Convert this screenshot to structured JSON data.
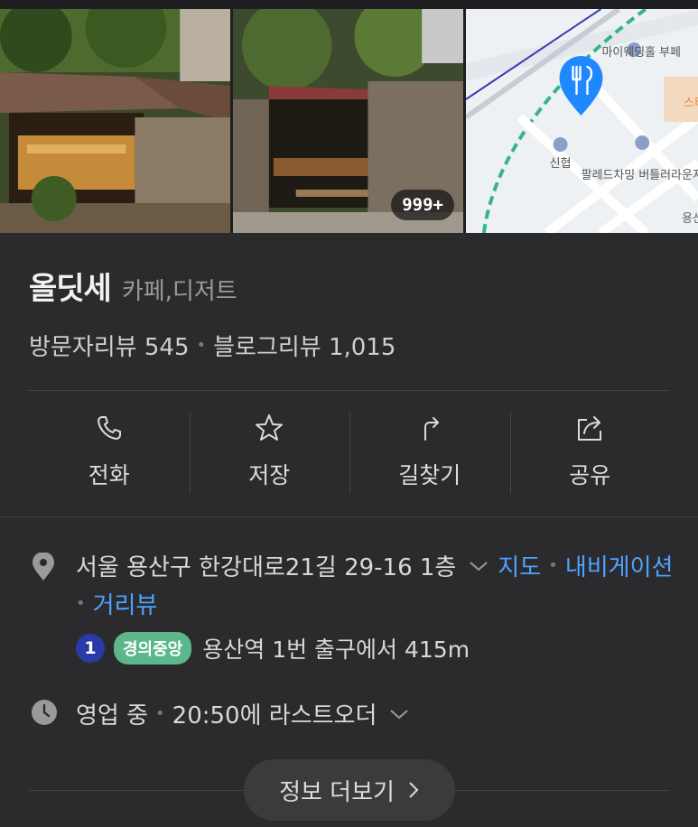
{
  "photos": {
    "count_badge": "999+",
    "map": {
      "labels": [
        "마이웨딩홀 부페",
        "신협",
        "팔레드차밍 버틀러라운지",
        "스티",
        "용산"
      ]
    }
  },
  "place": {
    "name": "올딧세",
    "category": "카페,디저트"
  },
  "reviews": {
    "visitor": "방문자리뷰 545",
    "blog": "블로그리뷰 1,015"
  },
  "actions": [
    {
      "label": "전화",
      "icon": "phone-icon"
    },
    {
      "label": "저장",
      "icon": "star-icon"
    },
    {
      "label": "길찾기",
      "icon": "directions-icon"
    },
    {
      "label": "공유",
      "icon": "share-icon"
    }
  ],
  "address": {
    "text": "서울 용산구 한강대로21길 29-16 1층",
    "links": [
      "지도",
      "내비게이션",
      "거리뷰"
    ]
  },
  "subway": {
    "line_number": "1",
    "line_name": "경의중앙",
    "directions": "용산역 1번 출구에서 415m",
    "line_color": "#2b3aa8",
    "line_name_color": "#5cb88a"
  },
  "hours": {
    "status": "영업 중",
    "last_order": "20:50에 라스트오더"
  },
  "more_info_label": "정보 더보기",
  "colors": {
    "background": "#2b2b2d",
    "link": "#4ea3ff",
    "map_pin": "#1e88ff"
  }
}
